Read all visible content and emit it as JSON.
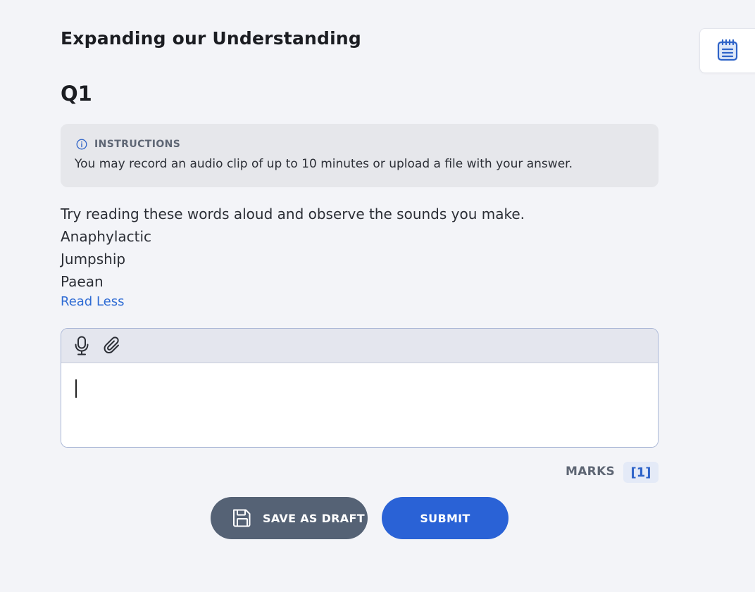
{
  "page": {
    "title": "Expanding our Understanding",
    "question_label": "Q1"
  },
  "instructions": {
    "icon": "info-icon",
    "title": "INSTRUCTIONS",
    "text": "You may record an audio clip of up to 10 minutes or upload a file with your answer."
  },
  "prompt": {
    "lines": [
      "Try reading these words aloud and observe the sounds you make.",
      "Anaphylactic",
      "Jumpship",
      "Paean"
    ],
    "toggle_label": "Read Less"
  },
  "answer": {
    "toolbar": {
      "record_icon": "microphone-icon",
      "attach_icon": "paperclip-icon"
    },
    "value": ""
  },
  "marks": {
    "label": "MARKS",
    "value": "[1]"
  },
  "actions": {
    "save_draft_label": "SAVE AS DRAFT",
    "save_draft_icon": "floppy-disk-icon",
    "submit_label": "SUBMIT"
  },
  "side_panel": {
    "icon": "notepad-icon"
  },
  "colors": {
    "background": "#f3f4f8",
    "primary": "#2a62d6",
    "secondary_button": "#556275",
    "instructions_bg": "#e6e7eb",
    "link": "#2e6bd4"
  }
}
